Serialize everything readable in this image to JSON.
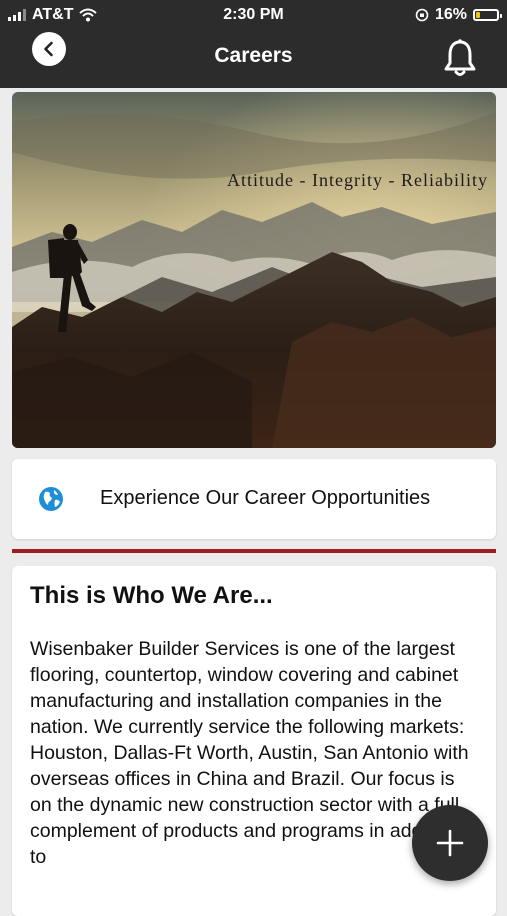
{
  "status_bar": {
    "carrier": "AT&T",
    "time": "2:30 PM",
    "battery_percent": "16%",
    "battery_level": 0.16,
    "battery_color": "#f1c40f"
  },
  "header": {
    "title": "Careers",
    "back_icon": "chevron-left-icon",
    "notification_icon": "bell-icon"
  },
  "hero": {
    "motto": "Attitude - Integrity - Reliability"
  },
  "careers_link": {
    "icon": "globe-icon",
    "label": "Experience Our Career Opportunities"
  },
  "about": {
    "title": "This is Who We Are...",
    "body": "Wisenbaker Builder Services is one of the largest flooring, countertop, window covering and cabinet manufacturing and installation companies in the nation. We currently service the following markets: Houston, Dallas-Ft Worth, Austin, San Antonio with overseas offices in China and Brazil. Our focus is on the dynamic new construction sector with a full complement of products and programs in addition to"
  },
  "fab": {
    "icon": "plus-icon"
  },
  "colors": {
    "accent": "#a21d22",
    "header_bg": "#2c2c2c",
    "globe": "#1e8fd6"
  }
}
